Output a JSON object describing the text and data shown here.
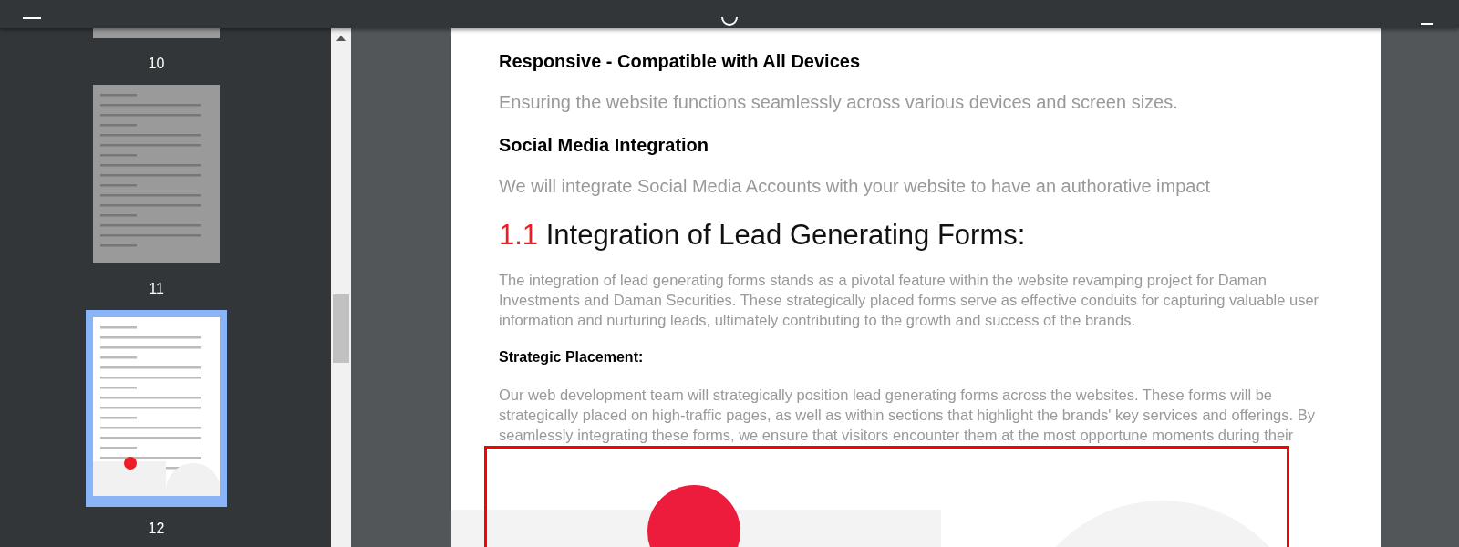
{
  "thumbnails": [
    {
      "label": "10",
      "selected": false
    },
    {
      "label": "11",
      "selected": false
    },
    {
      "label": "12",
      "selected": true
    }
  ],
  "document": {
    "blocks": [
      {
        "kind": "subheading",
        "text": "Responsive - Compatible with All Devices"
      },
      {
        "kind": "paragraph",
        "text": "Ensuring the website functions seamlessly across various devices and screen sizes."
      },
      {
        "kind": "subheading",
        "text": "Social Media Integration"
      },
      {
        "kind": "paragraph",
        "text": "We will integrate Social Media Accounts with your website to have an authorative impact"
      },
      {
        "kind": "heading",
        "number": "1.1",
        "text": "Integration of Lead Generating Forms:"
      },
      {
        "kind": "body",
        "text": "The integration of lead generating forms stands as a pivotal feature within the website revamping project for Daman Investments and Daman Securities. These strategically placed forms serve as effective conduits for capturing valuable user information and nurturing leads, ultimately contributing to the growth and success of the brands."
      },
      {
        "kind": "label",
        "text": "Strategic Placement:"
      },
      {
        "kind": "body",
        "text": "Our web development team will strategically position lead generating forms across the websites. These forms will be strategically placed on high-traffic pages, as well as within sections that highlight the brands' key services and offerings. By seamlessly integrating these forms, we ensure that visitors encounter them at the most opportune moments during their"
      }
    ]
  }
}
